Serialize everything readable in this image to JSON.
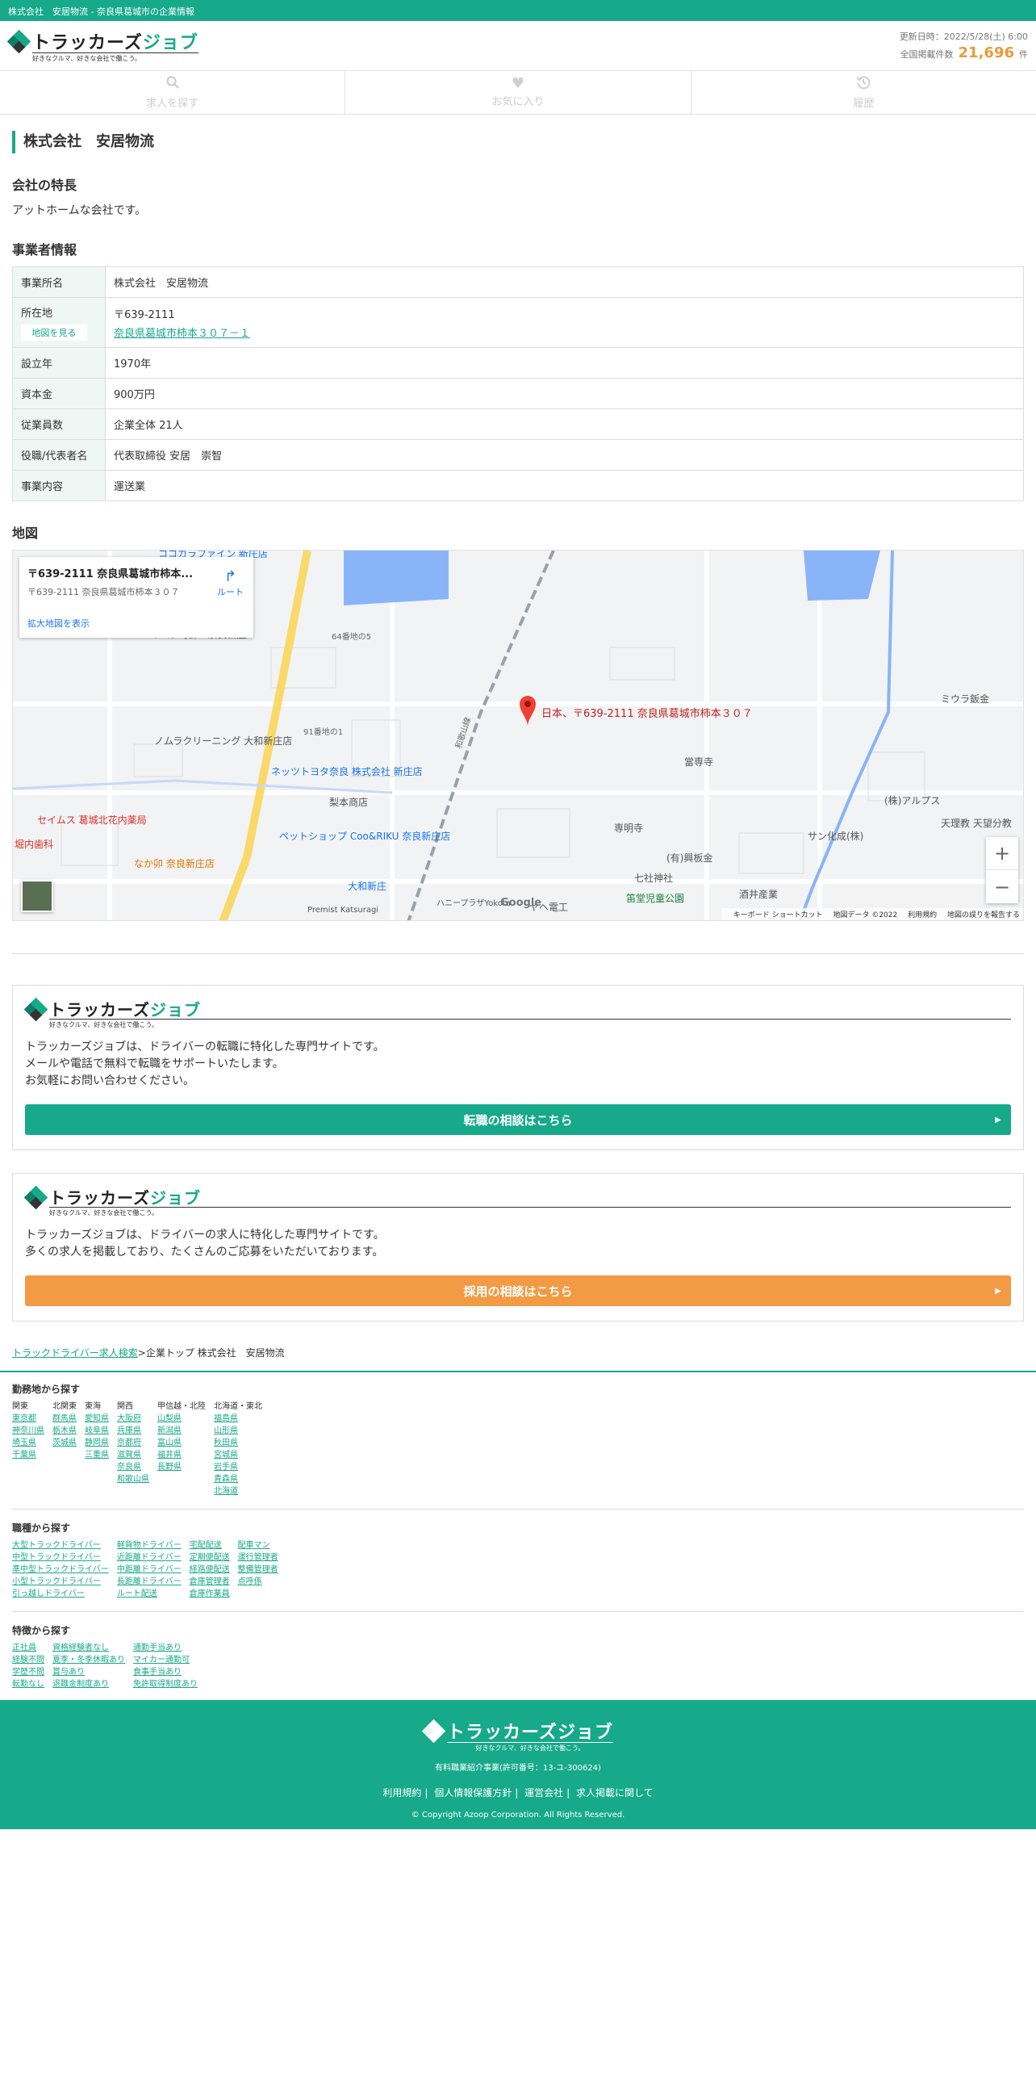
{
  "topbar": {
    "text": "株式会社　安居物流 - 奈良県葛城市の企業情報"
  },
  "brand": {
    "name_a": "トラッカーズ",
    "name_b": "ジョブ",
    "tagline": "好きなクルマ、好きな会社で働こう。"
  },
  "header": {
    "updated": "更新日時：2022/5/28(土) 6:00",
    "count_label": "全国掲載件数",
    "count": "21,696",
    "count_unit": "件"
  },
  "nav": {
    "search": "求人を探す",
    "favorites": "お気に入り",
    "history": "履歴"
  },
  "company": {
    "title": "株式会社　安居物流",
    "feature_heading": "会社の特長",
    "feature_text": "アットホームな会社です。",
    "info_heading": "事業者情報",
    "rows": {
      "name_label": "事業所名",
      "name": "株式会社　安居物流",
      "addr_label": "所在地",
      "map_btn": "地図を見る",
      "zip": "〒639-2111",
      "address": "奈良県葛城市柿本３０７－１",
      "founded_label": "設立年",
      "founded": "1970年",
      "capital_label": "資本金",
      "capital": "900万円",
      "employees_label": "従業員数",
      "employees": "企業全体 21人",
      "rep_label": "役職/代表者名",
      "rep": "代表取締役 安居　崇智",
      "business_label": "事業内容",
      "business": "運送業"
    }
  },
  "map": {
    "heading": "地図",
    "card_title": "〒639-2111 奈良県葛城市柿本...",
    "card_sub": "〒639-2111 奈良県葛城市柿本３０７",
    "card_link": "拡大地図を表示",
    "route": "ルート",
    "pin_label": "日本、〒639-2111 奈良県葛城市柿本３０７",
    "places": {
      "p1": "ココカラファイン 新庄店",
      "p2": "キムラ時計・奈良新庄",
      "p3": "64番地の5",
      "p4": "91番地の1",
      "p5": "ノムラクリーニング 大和新庄店",
      "p6": "ネッツトヨタ奈良 株式会社 新庄店",
      "p7": "梨本商店",
      "p8": "セイムス 葛城北花内薬局",
      "p9": "堀内歯科",
      "p10": "ペットショップ Coo&RIKU 奈良新庄店",
      "p11": "なか卯 奈良新庄店",
      "p12": "大和新庄",
      "p13": "Premist Katsuragi",
      "p14": "ハニープラザYokota",
      "p15": "當専寺",
      "p16": "専明寺",
      "p17": "七社神社",
      "p18": "(有)興板金",
      "p19": "笛堂児童公園",
      "p20": "酒井産業",
      "p21": "(株)アルプス",
      "p22": "天理教 天望分教",
      "p23": "サン化成(株)",
      "p24": "ミウラ鈑金",
      "p25": "和歌山線",
      "p26": "ヤヘ電工"
    },
    "google": "Google",
    "footer": [
      "キーボード ショートカット",
      "地図データ ©2022",
      "利用規約",
      "地図の誤りを報告する"
    ]
  },
  "promo1": {
    "lines": [
      "トラッカーズジョブは、ドライバーの転職に特化した専門サイトです。",
      "メールや電話で無料で転職をサポートいたします。",
      "お気軽にお問い合わせください。"
    ],
    "cta": "転職の相談はこちら"
  },
  "promo2": {
    "lines": [
      "トラッカーズジョブは、ドライバーの求人に特化した専門サイトです。",
      "多くの求人を掲載しており、たくさんのご応募をいただいております。"
    ],
    "cta": "採用の相談はこちら"
  },
  "breadcrumb": {
    "home": "トラックドライバー求人検索",
    "sep": ">",
    "current": "企業トップ 株式会社　安居物流"
  },
  "footer_links": {
    "area_heading": "勤務地から探す",
    "areas": [
      {
        "head": "関東",
        "items": [
          "東京都",
          "神奈川県",
          "埼玉県",
          "千葉県"
        ]
      },
      {
        "head": "北関東",
        "items": [
          "群馬県",
          "栃木県",
          "茨城県"
        ]
      },
      {
        "head": "東海",
        "items": [
          "愛知県",
          "岐阜県",
          "静岡県",
          "三重県"
        ]
      },
      {
        "head": "関西",
        "items": [
          "大阪府",
          "兵庫県",
          "京都府",
          "滋賀県",
          "奈良県",
          "和歌山県"
        ]
      },
      {
        "head": "甲信越・北陸",
        "items": [
          "山梨県",
          "新潟県",
          "富山県",
          "福井県",
          "長野県"
        ]
      },
      {
        "head": "北海道・東北",
        "items": [
          "福島県",
          "山形県",
          "秋田県",
          "宮城県",
          "岩手県",
          "青森県",
          "北海道"
        ]
      }
    ],
    "job_heading": "職種から探す",
    "jobs": [
      [
        "大型トラックドライバー",
        "中型トラックドライバー",
        "準中型トラックドライバー",
        "小型トラックドライバー",
        "引っ越しドライバー"
      ],
      [
        "軽貨物ドライバー",
        "近距離ドライバー",
        "中距離ドライバー",
        "長距離ドライバー",
        "ルート配送"
      ],
      [
        "宅配配送",
        "定期便配送",
        "経路便配送",
        "倉庫管理者",
        "倉庫作業員"
      ],
      [
        "配車マン",
        "運行管理者",
        "整備管理者",
        "点呼係"
      ]
    ],
    "feature_heading": "特徴から探す",
    "features": [
      [
        "正社員",
        "経験不問",
        "学歴不問",
        "転勤なし"
      ],
      [
        "資格経験者なし",
        "夏季・冬季休暇あり",
        "賞与あり",
        "退職金制度あり"
      ],
      [
        "通勤手当あり",
        "マイカー通勤可",
        "食事手当あり",
        "免許取得制度あり"
      ]
    ]
  },
  "site_footer": {
    "license": "有料職業紹介事業(許可番号：13-ユ-300624)",
    "links": [
      "利用規約",
      "個人情報保護方針",
      "運営会社",
      "求人掲載に関して"
    ],
    "copyright": "© Copyright Azoop Corporation. All Rights Reserved."
  },
  "colors": {
    "brand": "#16a98a",
    "accent": "#f39a44",
    "count": "#e89a3c"
  }
}
